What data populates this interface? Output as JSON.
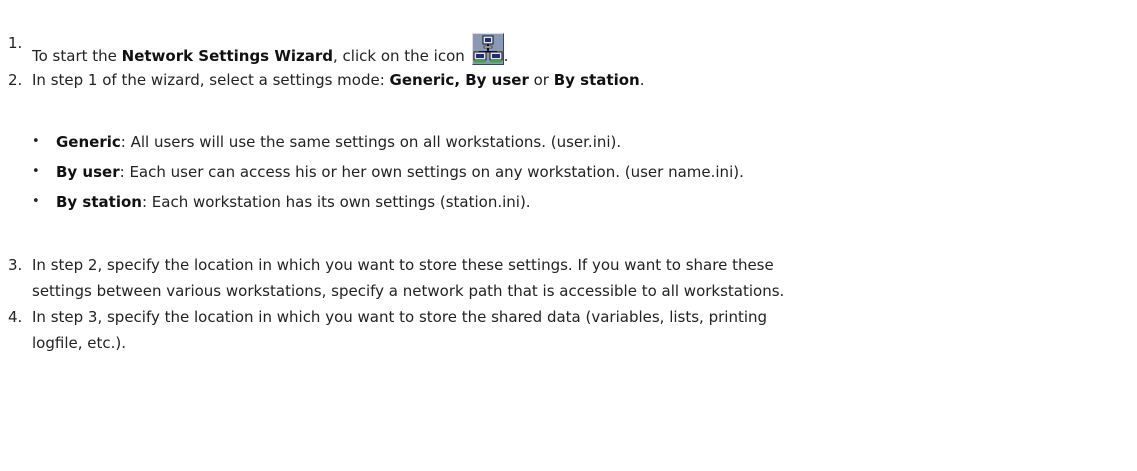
{
  "steps": {
    "s1": {
      "num": "1.",
      "pre": "To start the ",
      "bold": "Network Settings Wizard",
      "post": ", click on the icon",
      "trail": ".",
      "icon": "network-workstations-icon"
    },
    "s2": {
      "num": "2.",
      "pre": "In step 1 of the wizard, select a settings mode: ",
      "bold1": "Generic, By user",
      "mid": " or ",
      "bold2": "By station",
      "post": "."
    },
    "s3": {
      "num": "3.",
      "line1": "In step 2, specify the location in which you want to store these settings. If you want to share these",
      "line2": "settings between various workstations, specify a network path that is accessible to all workstations."
    },
    "s4": {
      "num": "4.",
      "line1": "In step 3, specify the location in which you want to store the shared data (variables, lists, printing",
      "line2": "logfile, etc.)."
    }
  },
  "modes": [
    {
      "bullet": "•",
      "name": "Generic",
      "desc": ": All users will use the same settings on all workstations. (user.ini)."
    },
    {
      "bullet": "•",
      "name": "By user",
      "desc": ": Each user can access his or her own settings on any workstation. (user name.ini)."
    },
    {
      "bullet": "•",
      "name": "By station",
      "desc": ": Each workstation has its own settings (station.ini)."
    }
  ]
}
